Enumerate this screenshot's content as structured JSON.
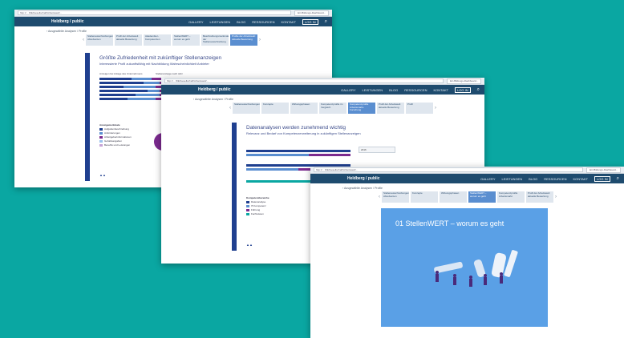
{
  "browser": {
    "address": "http://... /DE/Gesellschaft/Arbeitswelt/...",
    "tab_title": "Ein Bildungs-Dashboard..."
  },
  "nav": {
    "logo": "Heldberg / public",
    "items": [
      "GALLERY",
      "LEISTUNGEN",
      "BLOG",
      "RESSOURCEN",
      "KONTAKT"
    ],
    "login": "LOG IN"
  },
  "crumb": "‹ Ausgewählte Analysen / Profile",
  "shot1": {
    "tabs": [
      "Stellenausschreibungen Absolventen",
      "Profil der Arbeitswelt aktuelle Bewertung",
      "Akademiker-Kompetenzen",
      "StellenWERT – worum es geht",
      "Beschreibungsmerkmale der Stellenausschreibung",
      "Profile der Arbeitswelt: Aktuelle Bewertung"
    ],
    "title": "Größte Zufriedenheit mit zukünftiger Stellenanzeigen",
    "subtitle": "Interessierte Profil zukunftsfähig mit Nachbildung Wahrscheinlichkeit Anbieter",
    "chart_heading1": "Anzeigen bei Anlage des Unternehmens",
    "chart_heading2": "Stellenanzeige nach Jahr",
    "select": "2016",
    "legend_title": "Anzeigemerkmale",
    "legend": [
      "Aufgabenbeschreibung",
      "Anforderungen",
      "Arbeitgeberinformationen",
      "Gehaltsangaben",
      "Benefits und Leistungen"
    ]
  },
  "shot2": {
    "tabs": [
      "Stellenausschreibungen",
      "Konzepte",
      "Wirkungsphasen",
      "Kompetenzprofile im Vergleich",
      "Kompetenzprofile Arbeitsmarkt-Forschung",
      "Profil der Arbeitswelt aktuelle Bewertung",
      "Profil"
    ],
    "title": "Datenanalysen werden zunehmend wichtig",
    "subtitle": "Relevanz und Bedarf von Kompetenzerweiterung in zukünftigen Stellenanzeigen",
    "select": "2016",
    "legend_title": "Kompetenzbereiche",
    "legend": [
      "Datenanalyse",
      "IT-Kompetenz",
      "Führung",
      "Fachwissen"
    ]
  },
  "shot3": {
    "tabs": [
      "Stellenausschreibungen Absolventen",
      "Konzepte",
      "Wirkungsphasen",
      "StellenWERT – worum es geht",
      "Kompetenzprofile Arbeitsmarkt",
      "Profil der Arbeitswelt aktuelle Bewertung"
    ],
    "title": "01 StellenWERT – worum es geht",
    "hero_text": "01"
  },
  "colors": {
    "background": "#0aa7a2",
    "nav": "#1e4b6e",
    "accent": "#5a8ed0",
    "purple": "#7b2a8e",
    "navy": "#1f3f8f"
  }
}
